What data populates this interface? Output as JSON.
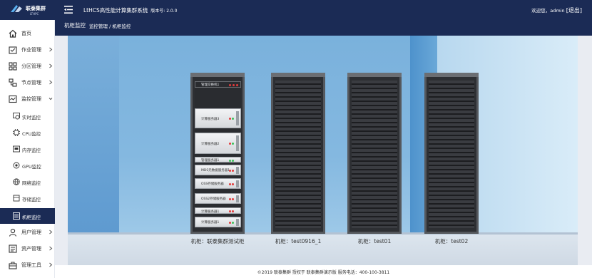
{
  "app": {
    "logo_text": "联泰集群",
    "logo_sub": "LTHPC",
    "title": "LtHCS高性能计算集群系统",
    "version_label": "版本号: 2.0.0",
    "welcome": "欢迎您，admin",
    "logout": "[退出]"
  },
  "sidebar": {
    "items": [
      {
        "label": "首页",
        "icon": "home-icon"
      },
      {
        "label": "作业管理",
        "icon": "job-icon"
      },
      {
        "label": "分区管理",
        "icon": "partition-icon"
      },
      {
        "label": "节点管理",
        "icon": "node-icon"
      },
      {
        "label": "监控管理",
        "icon": "monitor-icon"
      }
    ],
    "sub_items": [
      {
        "label": "实时监控",
        "icon": "realtime-icon"
      },
      {
        "label": "CPU监控",
        "icon": "cpu-icon"
      },
      {
        "label": "内存监控",
        "icon": "memory-icon"
      },
      {
        "label": "GPU监控",
        "icon": "gpu-icon"
      },
      {
        "label": "网络监控",
        "icon": "network-icon"
      },
      {
        "label": "存储监控",
        "icon": "storage-icon"
      },
      {
        "label": "机柜监控",
        "icon": "rack-icon"
      }
    ],
    "bottom_items": [
      {
        "label": "用户管理",
        "icon": "user-icon"
      },
      {
        "label": "资产管理",
        "icon": "asset-icon"
      },
      {
        "label": "管理工具",
        "icon": "tools-icon"
      }
    ]
  },
  "page": {
    "title": "机柜监控",
    "breadcrumb": "监控管理 / 机柜监控"
  },
  "racks": [
    {
      "label": "机柜：联泰集群测试柜",
      "units": [
        "管理交换机1",
        "计算服务器3",
        "计算服务器2",
        "管理服务器1",
        "MDS元数据服务器1",
        "OSS存储服务器",
        "OSS2存储服务器",
        "计算服务器1",
        "计算服务器1"
      ]
    },
    {
      "label": "机柜：test0916_1"
    },
    {
      "label": "机柜：test01"
    },
    {
      "label": "机柜：test02"
    }
  ],
  "colors": {
    "nav_dark": "#1b2b55",
    "led_red": "#e23b3b",
    "led_green": "#3cc15a"
  },
  "footer": {
    "text": "©2019 联泰集群 授权于 联泰集群演示版   服务电话：400-100-3811"
  }
}
